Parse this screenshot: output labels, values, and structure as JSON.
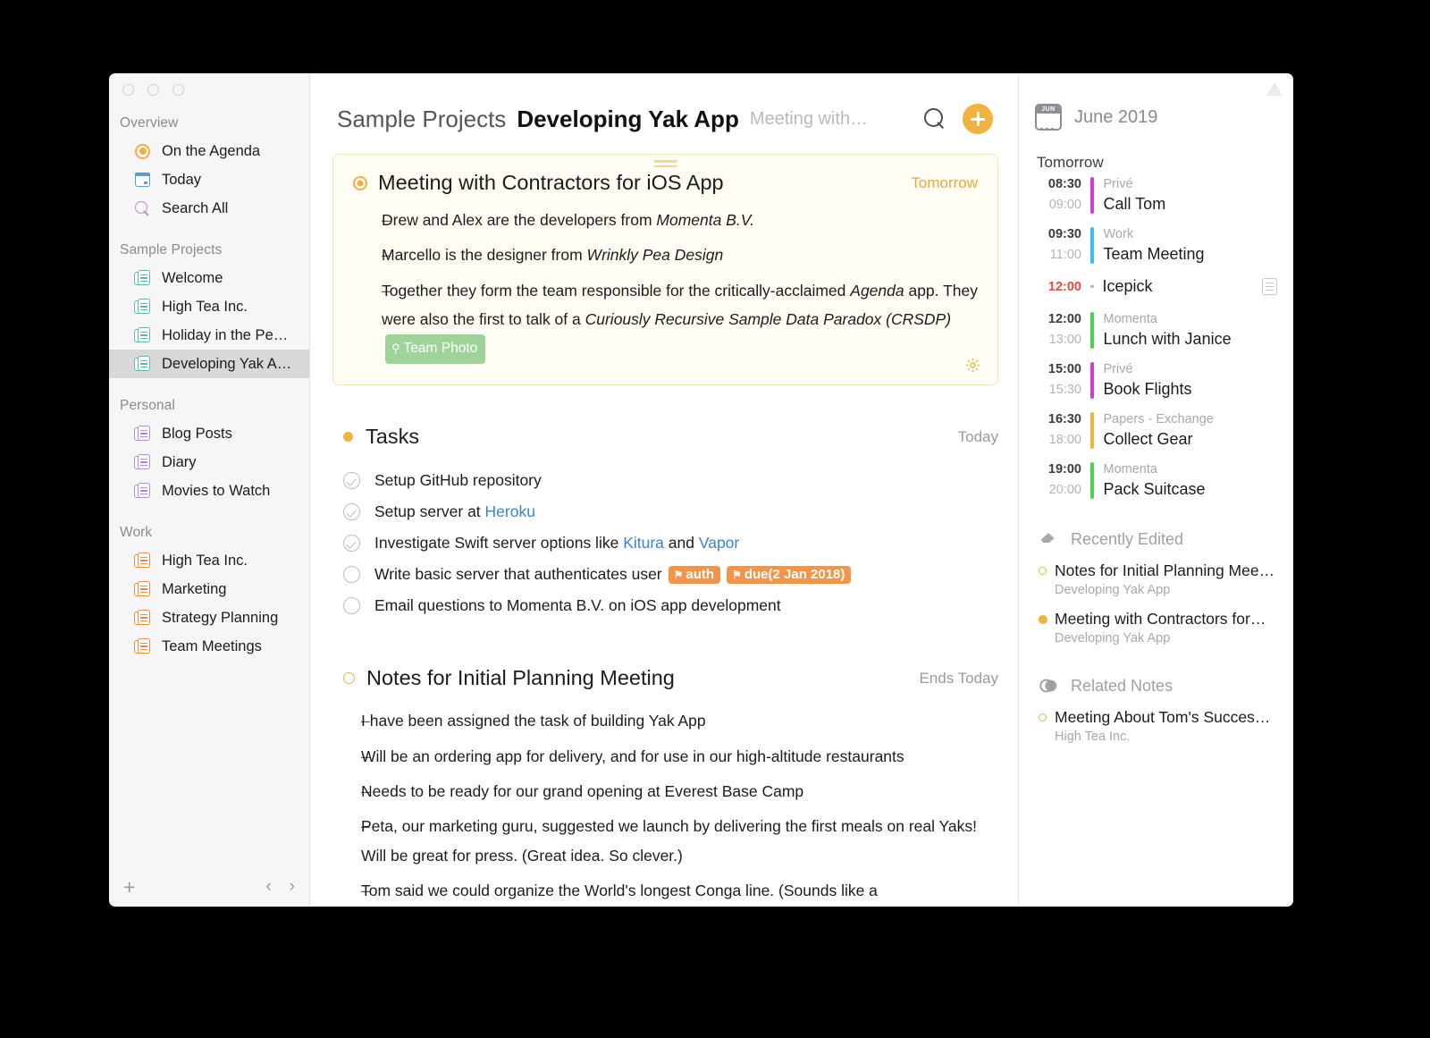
{
  "sidebar": {
    "sections": [
      {
        "title": "Overview",
        "items": [
          {
            "label": "On the Agenda",
            "icon": "agenda-dot-icon",
            "selected": false
          },
          {
            "label": "Today",
            "icon": "calendar-icon",
            "selected": false
          },
          {
            "label": "Search All",
            "icon": "search-icon",
            "selected": false
          }
        ]
      },
      {
        "title": "Sample Projects",
        "items": [
          {
            "label": "Welcome",
            "icon": "note-stack-icon",
            "color": "teal",
            "selected": false
          },
          {
            "label": "High Tea Inc.",
            "icon": "note-stack-icon",
            "color": "teal",
            "selected": false
          },
          {
            "label": "Holiday in the Pe…",
            "icon": "note-stack-icon",
            "color": "teal",
            "selected": false
          },
          {
            "label": "Developing Yak A…",
            "icon": "note-stack-icon",
            "color": "teal",
            "selected": true
          }
        ]
      },
      {
        "title": "Personal",
        "items": [
          {
            "label": "Blog Posts",
            "icon": "note-stack-icon",
            "color": "purple",
            "selected": false
          },
          {
            "label": "Diary",
            "icon": "note-stack-icon",
            "color": "purple",
            "selected": false
          },
          {
            "label": "Movies to Watch",
            "icon": "note-stack-icon",
            "color": "purple",
            "selected": false
          }
        ]
      },
      {
        "title": "Work",
        "items": [
          {
            "label": "High Tea Inc.",
            "icon": "note-stack-icon",
            "color": "orange",
            "selected": false
          },
          {
            "label": "Marketing",
            "icon": "note-stack-icon",
            "color": "orange",
            "selected": false
          },
          {
            "label": "Strategy Planning",
            "icon": "note-stack-icon",
            "color": "orange",
            "selected": false
          },
          {
            "label": "Team Meetings",
            "icon": "note-stack-icon",
            "color": "orange",
            "selected": false
          }
        ]
      }
    ],
    "footer": {
      "add_label": "+",
      "prev_label": "‹",
      "next_label": "›"
    }
  },
  "header": {
    "breadcrumb_project_group": "Sample Projects",
    "breadcrumb_project": "Developing Yak App",
    "breadcrumb_note": "Meeting with…",
    "search_icon": "search-icon",
    "add_icon": "plus-icon"
  },
  "note_card": {
    "title": "Meeting with Contractors for iOS App",
    "when": "Tomorrow",
    "status_icon": "filled-ring-icon",
    "gear_icon": "gear-icon",
    "bullets": [
      {
        "dash": "–",
        "parts": [
          {
            "t": "Drew and Alex are the developers from ",
            "i": false
          },
          {
            "t": "Momenta B.V.",
            "i": true
          }
        ]
      },
      {
        "dash": "–",
        "parts": [
          {
            "t": "Marcello is the designer from ",
            "i": false
          },
          {
            "t": "Wrinkly Pea Design",
            "i": true
          }
        ]
      },
      {
        "dash": "–",
        "parts": [
          {
            "t": "Together they form the team responsible for the critically-acclaimed ",
            "i": false
          },
          {
            "t": "Agenda",
            "i": true
          },
          {
            "t": " app. They were also the first to talk of a ",
            "i": false
          },
          {
            "t": "Curiously Recursive Sample Data Paradox (CRSDP)",
            "i": true
          }
        ],
        "pill": "Team Photo",
        "pill_icon": "people-icon"
      }
    ]
  },
  "tasks_section": {
    "title": "Tasks",
    "when": "Today",
    "status_icon": "filled-dot-icon",
    "items": [
      {
        "done": true,
        "parts": [
          {
            "t": "Setup GitHub repository"
          }
        ]
      },
      {
        "done": true,
        "parts": [
          {
            "t": "Setup server at "
          },
          {
            "t": "Heroku",
            "link": true
          }
        ]
      },
      {
        "done": true,
        "parts": [
          {
            "t": "Investigate Swift server options like "
          },
          {
            "t": "Kitura",
            "link": true
          },
          {
            "t": " and "
          },
          {
            "t": "Vapor",
            "link": true
          }
        ]
      },
      {
        "done": false,
        "parts": [
          {
            "t": "Write basic server that authenticates user"
          }
        ],
        "tags": [
          "auth",
          "due(2 Jan 2018)"
        ],
        "tag_icon": "tag-icon"
      },
      {
        "done": false,
        "parts": [
          {
            "t": "Email questions to Momenta B.V. on iOS app development"
          }
        ]
      }
    ]
  },
  "notes_section": {
    "title": "Notes for Initial Planning Meeting",
    "when": "Ends Today",
    "status_icon": "open-ring-icon",
    "bullets": [
      {
        "dash": "–",
        "text": "I have been assigned the task of building Yak App"
      },
      {
        "dash": "–",
        "text": "Will be an ordering app for delivery, and for use in our high-altitude restaurants"
      },
      {
        "dash": "–",
        "text": "Needs to be ready for our grand opening at Everest Base Camp"
      },
      {
        "dash": "–",
        "text": "Peta, our marketing guru, suggested we launch by delivering the first meals on real Yaks! Will be great for press. (Great idea. So clever.)"
      },
      {
        "dash": "–",
        "text": "Tom said we could organize the World's longest Conga line. (Sounds like a"
      }
    ]
  },
  "right_panel": {
    "month": "June 2019",
    "month_icon": "calendar-icon",
    "month_badge": "JUN",
    "day_label": "Tomorrow",
    "events": [
      {
        "start": "08:30",
        "end": "09:00",
        "calendar": "Privé",
        "title": "Call Tom",
        "color": "#cc3fd0"
      },
      {
        "start": "09:30",
        "end": "11:00",
        "calendar": "Work",
        "title": "Team Meeting",
        "color": "#3fbced"
      },
      {
        "start": "12:00",
        "end": "",
        "calendar": "",
        "title": "Icepick",
        "color": "",
        "allday": true,
        "note_icon": "note-icon"
      },
      {
        "start": "12:00",
        "end": "13:00",
        "calendar": "Momenta",
        "title": "Lunch with Janice",
        "color": "#4ed14e"
      },
      {
        "start": "15:00",
        "end": "15:30",
        "calendar": "Privé",
        "title": "Book Flights",
        "color": "#cc3fd0"
      },
      {
        "start": "16:30",
        "end": "18:00",
        "calendar": "Papers - Exchange",
        "title": "Collect Gear",
        "color": "#f2b23e"
      },
      {
        "start": "19:00",
        "end": "20:00",
        "calendar": "Momenta",
        "title": "Pack Suitcase",
        "color": "#4ed14e"
      }
    ],
    "recently_edited": {
      "title": "Recently Edited",
      "icon": "eraser-icon",
      "items": [
        {
          "title": "Notes for Initial Planning Mee…",
          "project": "Developing Yak App",
          "marker": "open"
        },
        {
          "title": "Meeting with Contractors for…",
          "project": "Developing Yak App",
          "marker": "filled"
        }
      ]
    },
    "related_notes": {
      "title": "Related Notes",
      "icon": "overlap-circles-icon",
      "items": [
        {
          "title": "Meeting About Tom's Succes…",
          "project": "High Tea Inc.",
          "marker": "open"
        }
      ]
    }
  },
  "colors": {
    "accent": "#f2b23e",
    "link": "#3a82d2",
    "tag": "#f2954a",
    "pill_green": "#9ed39a",
    "card_bg": "#fffdf4",
    "selected_row": "#d8d8d8"
  }
}
